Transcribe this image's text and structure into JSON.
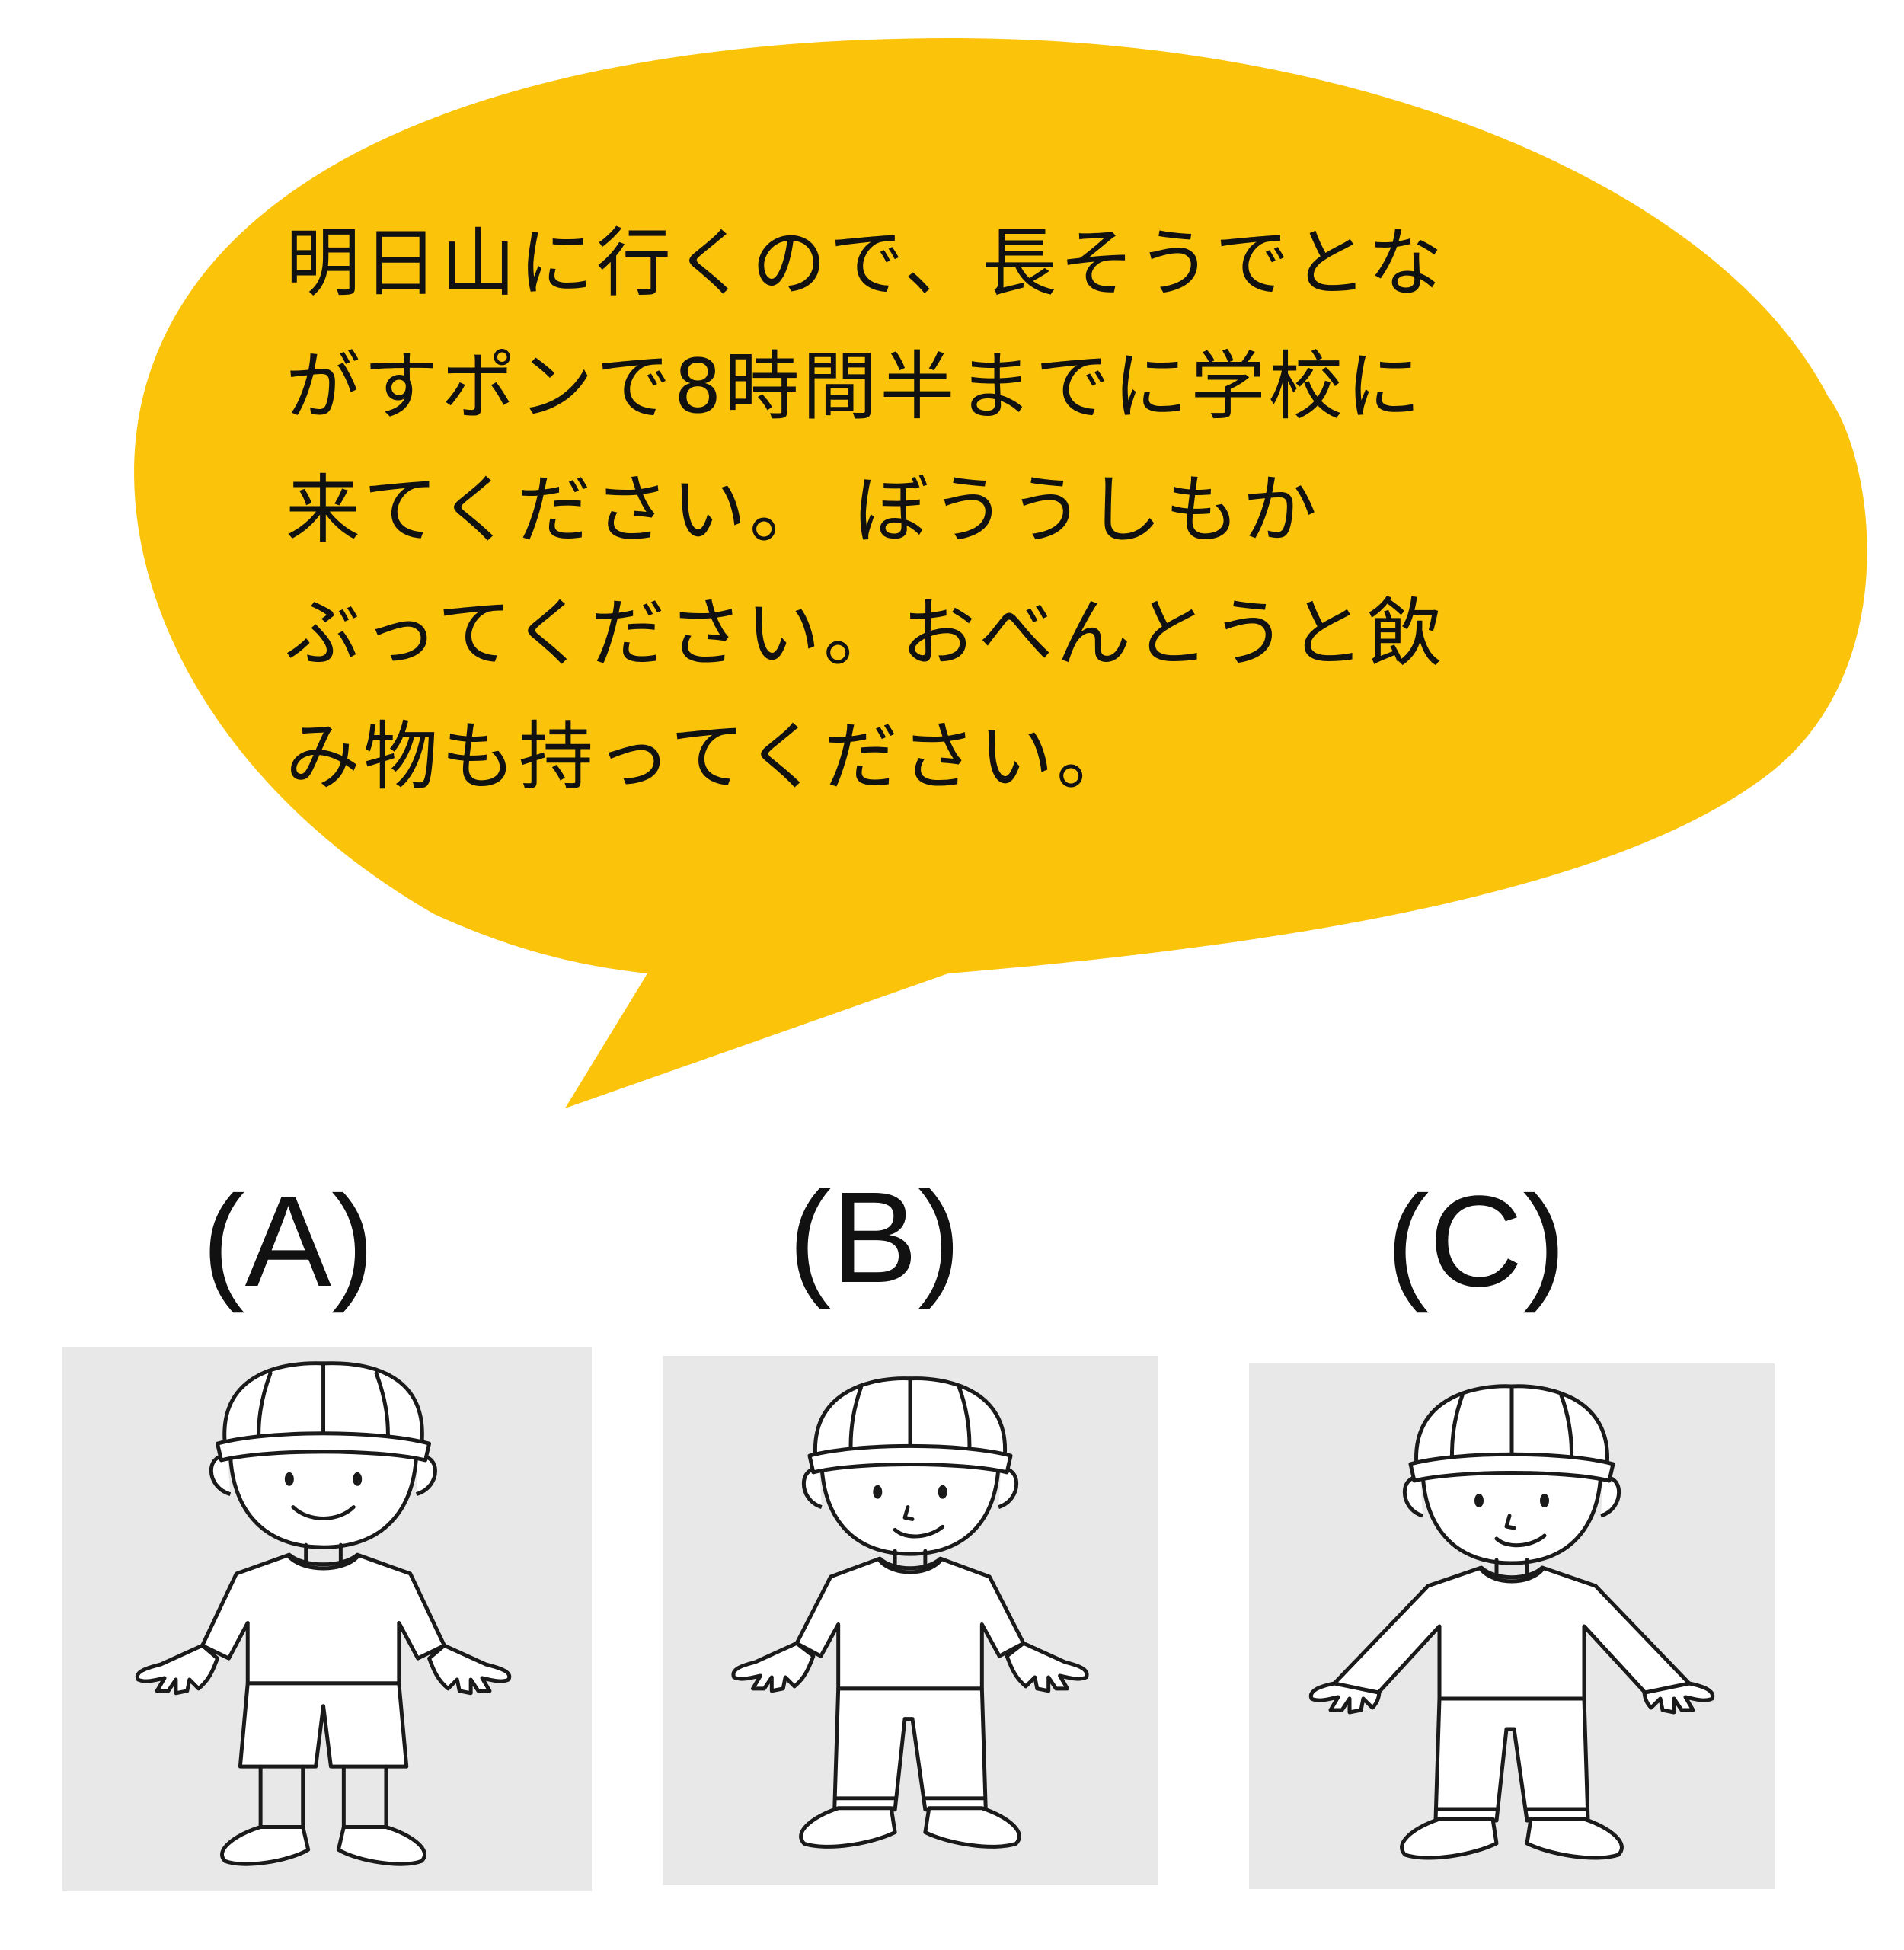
{
  "bubble": {
    "color": "#FBC30A",
    "lines": [
      "明日山に行くので、長そうでとな",
      "がすポンで8時間半までに学校に",
      "来てください。 ぼううしもか",
      "ぶってください。おべんとうと飲",
      "み物も持ってください。"
    ]
  },
  "options": [
    {
      "label": "(A)",
      "figure": "boy-cap-short-sleeves-shorts"
    },
    {
      "label": "(B)",
      "figure": "boy-cap-short-sleeves-long-pants"
    },
    {
      "label": "(C)",
      "figure": "boy-cap-long-sleeves-long-pants"
    }
  ]
}
